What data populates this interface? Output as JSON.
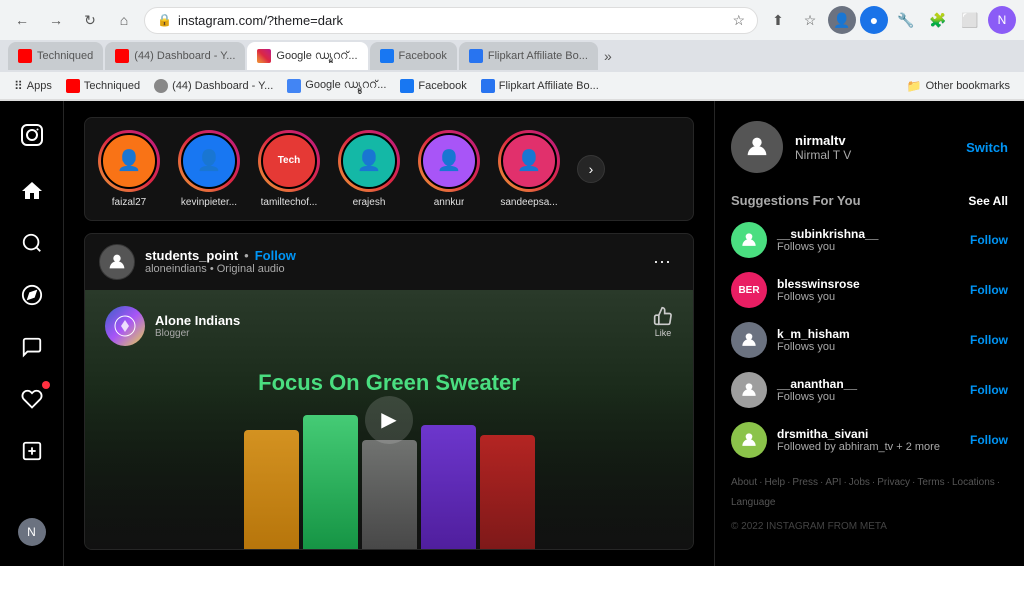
{
  "browser": {
    "address": "instagram.com/?theme=dark",
    "tabs": [
      {
        "label": "Techniqued",
        "active": false,
        "favicon_color": "#ff0000"
      },
      {
        "label": "(44) Dashboard - Y...",
        "active": false,
        "favicon_color": "#ff0000"
      },
      {
        "label": "Google ഡ്യൂററ്...",
        "active": true,
        "favicon_color": "#4285f4"
      },
      {
        "label": "Facebook",
        "active": false,
        "favicon_color": "#1877f2"
      },
      {
        "label": "Flipkart Affiliate Bo...",
        "active": false,
        "favicon_color": "#2874f0"
      }
    ],
    "bookmarks": [
      {
        "label": "Apps",
        "favicon_color": "#4285f4"
      },
      {
        "label": "Techniqued",
        "favicon_color": "#ff0000"
      },
      {
        "label": "(44) Dashboard - Y...",
        "favicon_color": "#ff0000"
      },
      {
        "label": "Google ഡ്യൂററ്...",
        "favicon_color": "#4285f4"
      },
      {
        "label": "Facebook",
        "favicon_color": "#1877f2"
      },
      {
        "label": "Flipkart Affiliate Bo...",
        "favicon_color": "#2874f0"
      },
      {
        "label": "Other bookmarks",
        "favicon_color": "#f5a623"
      }
    ]
  },
  "instagram": {
    "stories": [
      {
        "name": "faizal27",
        "color": "#e6683c"
      },
      {
        "name": "kevinpieter...",
        "color": "#dc2743"
      },
      {
        "name": "tamiltechof...",
        "color": "#cc2366"
      },
      {
        "name": "erajesh",
        "color": "#bc1888"
      },
      {
        "name": "annkur",
        "color": "#f09433"
      },
      {
        "name": "sandeepsa...",
        "color": "#e6683c"
      }
    ],
    "post": {
      "username": "students_point",
      "follow_label": "Follow",
      "subtitle": "aloneindians",
      "audio": "Original audio",
      "blog_name": "Alone Indians",
      "blog_type": "Blogger",
      "green_text": "Focus On Green Sweater",
      "like_label": "Like"
    },
    "profile": {
      "username": "nirmaltv",
      "display_name": "Nirmal T V",
      "switch_label": "Switch"
    },
    "suggestions_title": "Suggestions For You",
    "see_all_label": "See All",
    "suggestions": [
      {
        "username": "__subinkrishna__",
        "sub": "Follows you",
        "color": "#4ade80"
      },
      {
        "username": "blesswinsrose",
        "sub": "Follows you",
        "color": "#e91e63"
      },
      {
        "username": "k_m_hisham",
        "sub": "Follows you",
        "color": "#607d8b"
      },
      {
        "username": "__ananthan__",
        "sub": "Follows you",
        "color": "#9e9e9e"
      },
      {
        "username": "drsmitha_sivani",
        "sub": "Followed by abhiram_tv + 2 more",
        "color": "#8bc34a"
      }
    ],
    "follow_label": "Follow",
    "footer": {
      "links": [
        "About",
        "Help",
        "Press",
        "API",
        "Jobs",
        "Privacy",
        "Terms",
        "Locations",
        "Language"
      ],
      "copyright": "© 2022 INSTAGRAM FROM META"
    }
  }
}
